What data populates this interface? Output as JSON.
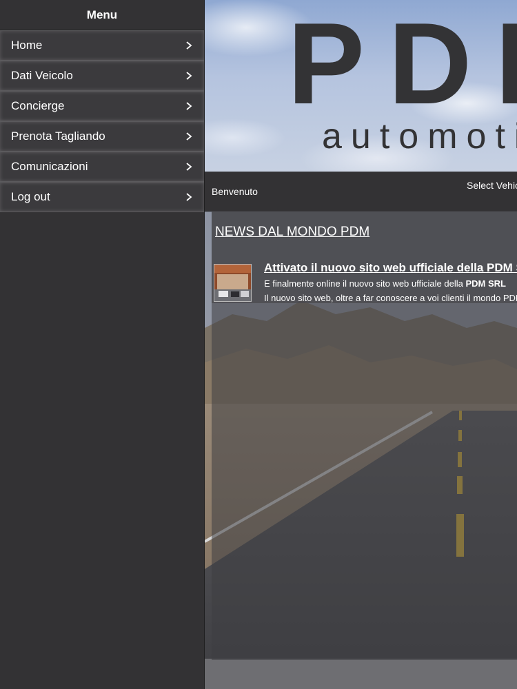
{
  "menu": {
    "title": "Menu",
    "items": [
      {
        "label": "Home"
      },
      {
        "label": "Dati Veicolo"
      },
      {
        "label": "Concierge"
      },
      {
        "label": "Prenota Tagliando"
      },
      {
        "label": "Comunicazioni"
      },
      {
        "label": "Log out"
      }
    ]
  },
  "header": {
    "logo_text": "PDM",
    "logo_subtitle": "automotive"
  },
  "topbar": {
    "welcome": "Benvenuto",
    "select_vehicle": "Select Vehicle"
  },
  "news": {
    "heading": "NEWS DAL MONDO PDM",
    "article": {
      "title": "Attivato il nuovo sito web ufficiale della PDM S.r.l.",
      "line1_prefix": "E finalmente online il nuovo sito web ufficiale della ",
      "line1_bold": "PDM SRL",
      "line2": "Il nuovo sito web, oltre a far conoscere a voi clienti il mondo PDM"
    }
  },
  "colors": {
    "menu_bg": "#333234",
    "menu_item_bg": "#3b3a3d",
    "text": "#ffffff",
    "logo": "#333335"
  }
}
